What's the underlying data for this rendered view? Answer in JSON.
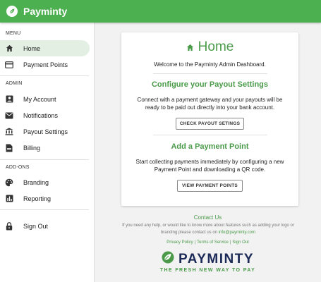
{
  "app": {
    "title": "Payminty"
  },
  "sidebar": {
    "sections": [
      {
        "label": "MENU"
      },
      {
        "label": "ADMIN"
      },
      {
        "label": "ADD-ONS"
      }
    ],
    "items": [
      {
        "label": "Home",
        "icon": "home-icon",
        "active": true
      },
      {
        "label": "Payment Points",
        "icon": "card-icon"
      },
      {
        "label": "My Account",
        "icon": "account-box-icon"
      },
      {
        "label": "Notifications",
        "icon": "mail-icon"
      },
      {
        "label": "Payout Settings",
        "icon": "bank-icon"
      },
      {
        "label": "Billing",
        "icon": "document-icon"
      },
      {
        "label": "Branding",
        "icon": "palette-icon"
      },
      {
        "label": "Reporting",
        "icon": "chart-icon"
      },
      {
        "label": "Sign Out",
        "icon": "lock-icon"
      }
    ]
  },
  "card": {
    "title": "Home",
    "welcome": "Welcome to the Payminty Admin Dashboard.",
    "payout": {
      "heading": "Configure your Payout Settings",
      "text": "Connect with a payment gateway and your payouts will be ready to be paid out directly into your bank account.",
      "button": "CHECK PAYOUT SETINGS"
    },
    "payment_point": {
      "heading": "Add a Payment Point",
      "text": "Start collecting payments immediately by configuring a new Payment Point and downloading a QR code.",
      "button": "VIEW PAYMENT POINTS"
    }
  },
  "footer": {
    "contact_title": "Contact Us",
    "contact_text": "If you need any help, or would like to know more about features such as adding your logo or branding please contact us on",
    "email": "info@payminty.com",
    "links": [
      "Privacy Policy",
      "Terms of Service",
      "Sign Out"
    ],
    "brand": "PAYMINTY",
    "tagline": "THE FRESH NEW WAY TO PAY"
  },
  "colors": {
    "primary": "#4caf50",
    "accent_text": "#4a9a4a",
    "brand_navy": "#1b2a57"
  }
}
